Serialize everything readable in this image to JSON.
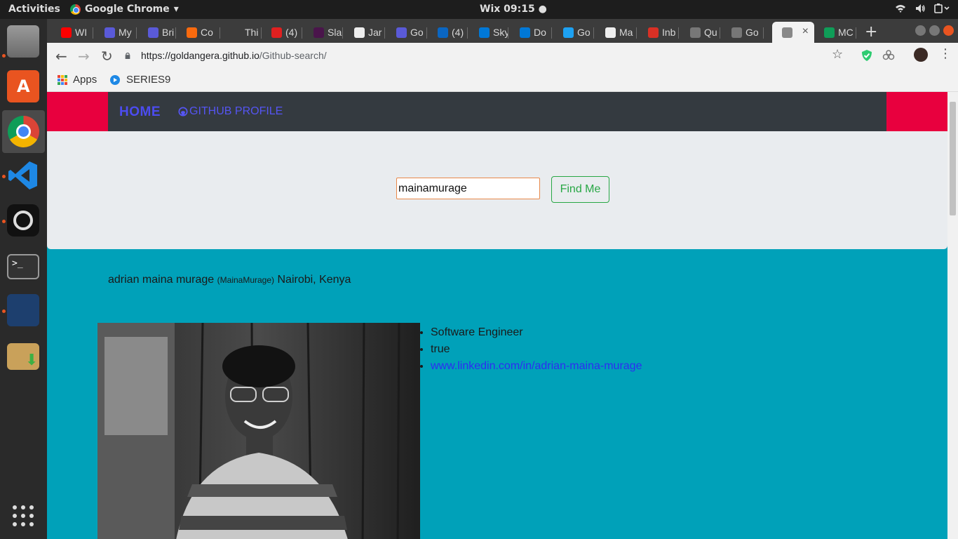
{
  "os": {
    "activities": "Activities",
    "app_name": "Google Chrome",
    "clock": "Wix 09:15 ●"
  },
  "browser": {
    "tabs": [
      {
        "label": "WI",
        "favicon_color": "#ff0000"
      },
      {
        "label": "My",
        "favicon_color": "#5a5ad8"
      },
      {
        "label": "Bri",
        "favicon_color": "#5a5ad8"
      },
      {
        "label": "Co",
        "favicon_color": "#f96a0e"
      },
      {
        "label": "Thi",
        "favicon_color": "#3c3c3c"
      },
      {
        "label": "(4)",
        "favicon_color": "#e02020"
      },
      {
        "label": "Sla",
        "favicon_color": "#4a154b"
      },
      {
        "label": "Jar",
        "favicon_color": "#eeeeee"
      },
      {
        "label": "Go",
        "favicon_color": "#5a5ad8"
      },
      {
        "label": "(4)",
        "favicon_color": "#0a66c2"
      },
      {
        "label": "Sky",
        "favicon_color": "#0078d7"
      },
      {
        "label": "Do",
        "favicon_color": "#0078d7"
      },
      {
        "label": "Go",
        "favicon_color": "#1da1f2"
      },
      {
        "label": "Ma",
        "favicon_color": "#eeeeee"
      },
      {
        "label": "Inb",
        "favicon_color": "#d93025"
      },
      {
        "label": "Qu",
        "favicon_color": "#777777"
      },
      {
        "label": "Go",
        "favicon_color": "#777777"
      },
      {
        "label": "",
        "favicon_color": "#888888"
      },
      {
        "label": "MC",
        "favicon_color": "#0f9d58"
      }
    ],
    "active_tab_index": 17,
    "new_tab_symbol": "+",
    "address": {
      "host": "https://goldangera.github.io",
      "path": "/Github-search/"
    },
    "bookmarks": [
      {
        "label": "Apps"
      },
      {
        "label": "SERIES9"
      }
    ]
  },
  "page": {
    "navbar": {
      "brand": "HOME",
      "link": "GITHUB PROFILE"
    },
    "search": {
      "value": "mainamurage",
      "button_label": "Find Me"
    },
    "profile": {
      "name": "adrian maina murage",
      "login": "(MainaMurage)",
      "location": "Nairobi, Kenya",
      "details": [
        "Software Engineer",
        "true"
      ],
      "link": "www.linkedin.com/in/adrian-maina-murage"
    }
  },
  "colors": {
    "nav_band": "#e8003e",
    "navbar": "#343a40",
    "brand": "#4c4cf0",
    "page_bg": "#00a1b9",
    "panel_bg": "#e9ecef",
    "button": "#28a745"
  }
}
